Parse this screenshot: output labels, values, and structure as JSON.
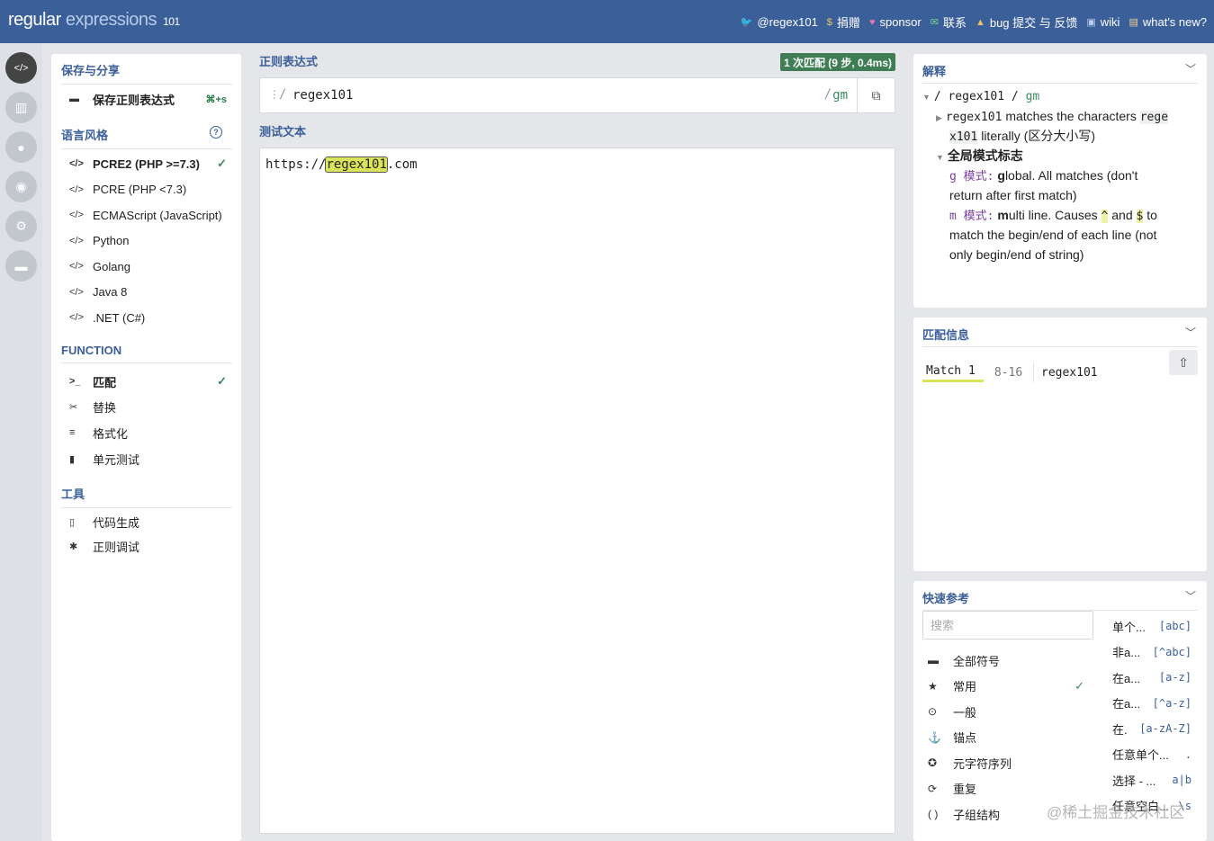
{
  "header": {
    "logo_main": "regular",
    "logo_sub": "expressions",
    "logo_num": "101",
    "links": [
      {
        "icon": "twitter-icon",
        "glyph": "🐦",
        "label": "@regex101",
        "color": "#9fc0f0"
      },
      {
        "icon": "dollar-icon",
        "glyph": "$",
        "label": "捐赠",
        "color": "#e9c46a"
      },
      {
        "icon": "heart-icon",
        "glyph": "♥",
        "label": "sponsor",
        "color": "#e07aa8"
      },
      {
        "icon": "mail-icon",
        "glyph": "✉",
        "label": "联系",
        "color": "#7fd19b"
      },
      {
        "icon": "warning-icon",
        "glyph": "▲",
        "label": "bug 提交 与 反馈",
        "color": "#f0c060"
      },
      {
        "icon": "wiki-icon",
        "glyph": "▣",
        "label": "wiki",
        "color": "#bcd0ee"
      },
      {
        "icon": "whats-new-icon",
        "glyph": "▤",
        "label": "what's new?",
        "color": "#f0d090"
      }
    ]
  },
  "rail": [
    {
      "icon": "code-icon",
      "glyph": "</>",
      "active": true
    },
    {
      "icon": "library-icon",
      "glyph": "▥"
    },
    {
      "icon": "user-icon",
      "glyph": "●"
    },
    {
      "icon": "gamepad-icon",
      "glyph": "◉"
    },
    {
      "icon": "settings-icon",
      "glyph": "⚙"
    },
    {
      "icon": "chat-icon",
      "glyph": "▬"
    }
  ],
  "left": {
    "save_title": "保存与分享",
    "save_label": "保存正则表达式",
    "save_shortcut": "⌘+s",
    "flavor_title": "语言风格",
    "flavors": [
      {
        "label": "PCRE2 (PHP >=7.3)",
        "selected": true
      },
      {
        "label": "PCRE (PHP <7.3)"
      },
      {
        "label": "ECMAScript (JavaScript)"
      },
      {
        "label": "Python"
      },
      {
        "label": "Golang"
      },
      {
        "label": "Java 8"
      },
      {
        "label": ".NET (C#)"
      }
    ],
    "function_title": "FUNCTION",
    "functions": [
      {
        "icon": "terminal-icon",
        "glyph": ">_",
        "label": "匹配",
        "selected": true
      },
      {
        "icon": "scissors-icon",
        "glyph": "✂",
        "label": "替换"
      },
      {
        "icon": "format-icon",
        "glyph": "≡",
        "label": "格式化"
      },
      {
        "icon": "test-tube-icon",
        "glyph": "▮",
        "label": "单元测试"
      }
    ],
    "tools_title": "工具",
    "tools": [
      {
        "icon": "code-file-icon",
        "glyph": "▯",
        "label": "代码生成"
      },
      {
        "icon": "bug-icon",
        "glyph": "✱",
        "label": "正则调试"
      }
    ]
  },
  "center": {
    "regex_label": "正则表达式",
    "match_badge": "1 次匹配 (9 步, 0.4ms)",
    "delimiter": "/",
    "pattern": "regex101",
    "flags": "gm",
    "test_label": "测试文本",
    "test_prefix": "https://",
    "test_match": "regex101",
    "test_suffix": ".com"
  },
  "explanation": {
    "title": "解释",
    "root_pattern": "regex101",
    "root_flags": "gm",
    "line1_code_a": "regex101",
    "line1_text": " matches the characters ",
    "line1_code_b1": "rege",
    "line1_code_b2": "x101",
    "line1_text2": " literally (区分大小写)",
    "global_title": "全局模式标志",
    "g_flag": "g 模式:",
    "g_bold": "g",
    "g_text1": "lobal. All matches (don't",
    "g_text2": "return after first match)",
    "m_flag": "m 模式:",
    "m_bold": "m",
    "m_text1": "ulti line. Causes ",
    "m_caret": "^",
    "m_and": " and ",
    "m_dollar": "$",
    "m_to": " to",
    "m_text2": "match the begin/end of each line (not",
    "m_text3": "only begin/end of string)"
  },
  "match_info": {
    "title": "匹配信息",
    "match_label": "Match 1",
    "range": "8-16",
    "value": "regex101"
  },
  "quick_ref": {
    "title": "快速参考",
    "search_placeholder": "搜索",
    "categories": [
      {
        "icon": "all-tokens-icon",
        "glyph": "▬",
        "label": "全部符号"
      },
      {
        "icon": "star-icon",
        "glyph": "★",
        "label": "常用",
        "selected": true
      },
      {
        "icon": "circle-dot-icon",
        "glyph": "⊙",
        "label": "一般"
      },
      {
        "icon": "anchor-icon",
        "glyph": "⚓",
        "label": "锚点"
      },
      {
        "icon": "meta-sequence-icon",
        "glyph": "✪",
        "label": "元字符序列"
      },
      {
        "icon": "repeat-icon",
        "glyph": "⟳",
        "label": "重复"
      },
      {
        "icon": "parentheses-icon",
        "glyph": "( )",
        "label": "子组结构"
      }
    ],
    "items": [
      {
        "label": "单个...",
        "token": "[abc]"
      },
      {
        "label": "非a...",
        "token": "[^abc]"
      },
      {
        "label": "在a...",
        "token": "[a-z]"
      },
      {
        "label": "在a...",
        "token": "[^a-z]"
      },
      {
        "label": "在.",
        "token": "[a-zA-Z]"
      },
      {
        "label": "任意单个...",
        "token": "."
      },
      {
        "label": "选择 - ...",
        "token": "a|b"
      },
      {
        "label": "任意空白...",
        "token": "\\s"
      }
    ]
  },
  "watermark": "@稀土掘金技术社区",
  "colors": {
    "header_bg": "#3b5f99",
    "accent": "#3b5f99",
    "match_badge_bg": "#3f7d55",
    "highlight": "#dbe358"
  }
}
